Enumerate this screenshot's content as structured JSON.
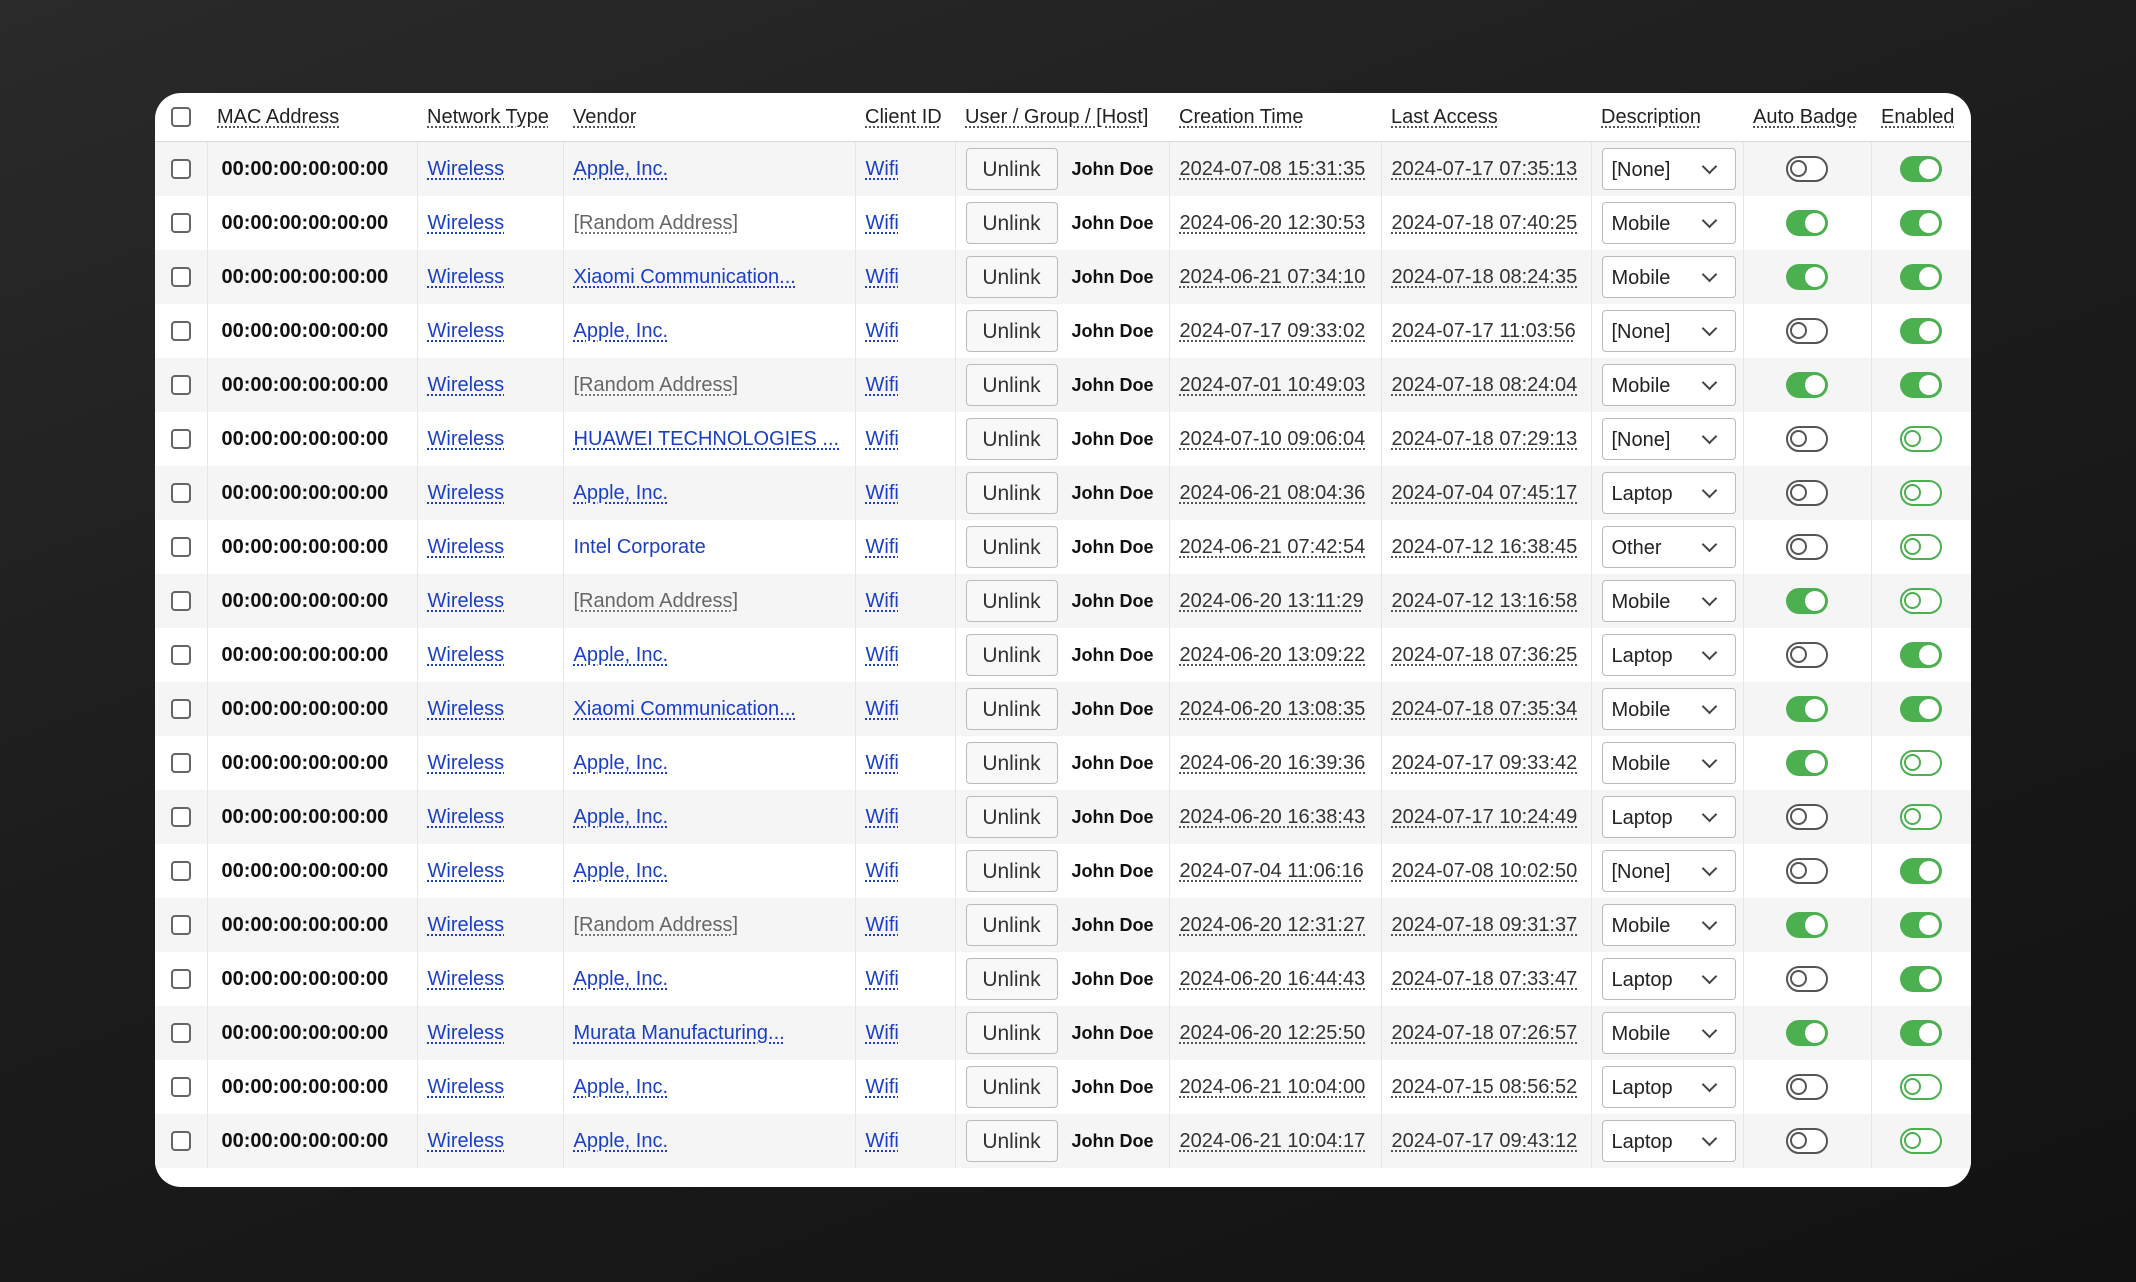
{
  "columns": [
    "MAC Address",
    "Network Type",
    "Vendor",
    "Client ID",
    "User / Group / [Host]",
    "Creation Time",
    "Last Access",
    "Description",
    "Auto Badge",
    "Enabled"
  ],
  "unlink_label": "Unlink",
  "rows": [
    {
      "mac": "00:00:00:00:00:00",
      "network": "Wireless",
      "vendor": "Apple, Inc.",
      "vendor_kind": "link",
      "client": "Wifi",
      "user": "John Doe",
      "created": "2024-07-08 15:31:35",
      "last": "2024-07-17 07:35:13",
      "desc": "[None]",
      "auto_badge": "off",
      "enabled": "on"
    },
    {
      "mac": "00:00:00:00:00:00",
      "network": "Wireless",
      "vendor": "[Random Address]",
      "vendor_kind": "random",
      "client": "Wifi",
      "user": "John Doe",
      "created": "2024-06-20 12:30:53",
      "last": "2024-07-18 07:40:25",
      "desc": "Mobile",
      "auto_badge": "on",
      "enabled": "on"
    },
    {
      "mac": "00:00:00:00:00:00",
      "network": "Wireless",
      "vendor": "Xiaomi Communication...",
      "vendor_kind": "link",
      "client": "Wifi",
      "user": "John Doe",
      "created": "2024-06-21 07:34:10",
      "last": "2024-07-18 08:24:35",
      "desc": "Mobile",
      "auto_badge": "on",
      "enabled": "on"
    },
    {
      "mac": "00:00:00:00:00:00",
      "network": "Wireless",
      "vendor": "Apple, Inc.",
      "vendor_kind": "link",
      "client": "Wifi",
      "user": "John Doe",
      "created": "2024-07-17 09:33:02",
      "last": "2024-07-17 11:03:56",
      "desc": "[None]",
      "auto_badge": "off",
      "enabled": "on"
    },
    {
      "mac": "00:00:00:00:00:00",
      "network": "Wireless",
      "vendor": "[Random Address]",
      "vendor_kind": "random",
      "client": "Wifi",
      "user": "John Doe",
      "created": "2024-07-01 10:49:03",
      "last": "2024-07-18 08:24:04",
      "desc": "Mobile",
      "auto_badge": "on",
      "enabled": "on"
    },
    {
      "mac": "00:00:00:00:00:00",
      "network": "Wireless",
      "vendor": "HUAWEI TECHNOLOGIES ...",
      "vendor_kind": "link",
      "client": "Wifi",
      "user": "John Doe",
      "created": "2024-07-10 09:06:04",
      "last": "2024-07-18 07:29:13",
      "desc": "[None]",
      "auto_badge": "off",
      "enabled": "ghost"
    },
    {
      "mac": "00:00:00:00:00:00",
      "network": "Wireless",
      "vendor": "Apple, Inc.",
      "vendor_kind": "link",
      "client": "Wifi",
      "user": "John Doe",
      "created": "2024-06-21 08:04:36",
      "last": "2024-07-04 07:45:17",
      "desc": "Laptop",
      "auto_badge": "off",
      "enabled": "ghost"
    },
    {
      "mac": "00:00:00:00:00:00",
      "network": "Wireless",
      "vendor": "Intel Corporate",
      "vendor_kind": "plain",
      "client": "Wifi",
      "user": "John Doe",
      "created": "2024-06-21 07:42:54",
      "last": "2024-07-12 16:38:45",
      "desc": "Other",
      "auto_badge": "off",
      "enabled": "ghost"
    },
    {
      "mac": "00:00:00:00:00:00",
      "network": "Wireless",
      "vendor": "[Random Address]",
      "vendor_kind": "random",
      "client": "Wifi",
      "user": "John Doe",
      "created": "2024-06-20 13:11:29",
      "last": "2024-07-12 13:16:58",
      "desc": "Mobile",
      "auto_badge": "on",
      "enabled": "ghost"
    },
    {
      "mac": "00:00:00:00:00:00",
      "network": "Wireless",
      "vendor": "Apple, Inc.",
      "vendor_kind": "link",
      "client": "Wifi",
      "user": "John Doe",
      "created": "2024-06-20 13:09:22",
      "last": "2024-07-18 07:36:25",
      "desc": "Laptop",
      "auto_badge": "off",
      "enabled": "on"
    },
    {
      "mac": "00:00:00:00:00:00",
      "network": "Wireless",
      "vendor": "Xiaomi Communication...",
      "vendor_kind": "link",
      "client": "Wifi",
      "user": "John Doe",
      "created": "2024-06-20 13:08:35",
      "last": "2024-07-18 07:35:34",
      "desc": "Mobile",
      "auto_badge": "on",
      "enabled": "on"
    },
    {
      "mac": "00:00:00:00:00:00",
      "network": "Wireless",
      "vendor": "Apple, Inc.",
      "vendor_kind": "link",
      "client": "Wifi",
      "user": "John Doe",
      "created": "2024-06-20 16:39:36",
      "last": "2024-07-17 09:33:42",
      "desc": "Mobile",
      "auto_badge": "on",
      "enabled": "ghost"
    },
    {
      "mac": "00:00:00:00:00:00",
      "network": "Wireless",
      "vendor": "Apple, Inc.",
      "vendor_kind": "link",
      "client": "Wifi",
      "user": "John Doe",
      "created": "2024-06-20 16:38:43",
      "last": "2024-07-17 10:24:49",
      "desc": "Laptop",
      "auto_badge": "off",
      "enabled": "ghost"
    },
    {
      "mac": "00:00:00:00:00:00",
      "network": "Wireless",
      "vendor": "Apple, Inc.",
      "vendor_kind": "link",
      "client": "Wifi",
      "user": "John Doe",
      "created": "2024-07-04 11:06:16",
      "last": "2024-07-08 10:02:50",
      "desc": "[None]",
      "auto_badge": "off",
      "enabled": "on"
    },
    {
      "mac": "00:00:00:00:00:00",
      "network": "Wireless",
      "vendor": "[Random Address]",
      "vendor_kind": "random",
      "client": "Wifi",
      "user": "John Doe",
      "created": "2024-06-20 12:31:27",
      "last": "2024-07-18 09:31:37",
      "desc": "Mobile",
      "auto_badge": "on",
      "enabled": "on"
    },
    {
      "mac": "00:00:00:00:00:00",
      "network": "Wireless",
      "vendor": "Apple, Inc.",
      "vendor_kind": "link",
      "client": "Wifi",
      "user": "John Doe",
      "created": "2024-06-20 16:44:43",
      "last": "2024-07-18 07:33:47",
      "desc": "Laptop",
      "auto_badge": "off",
      "enabled": "on"
    },
    {
      "mac": "00:00:00:00:00:00",
      "network": "Wireless",
      "vendor": "Murata Manufacturing...",
      "vendor_kind": "link",
      "client": "Wifi",
      "user": "John Doe",
      "created": "2024-06-20 12:25:50",
      "last": "2024-07-18 07:26:57",
      "desc": "Mobile",
      "auto_badge": "on",
      "enabled": "on"
    },
    {
      "mac": "00:00:00:00:00:00",
      "network": "Wireless",
      "vendor": "Apple, Inc.",
      "vendor_kind": "link",
      "client": "Wifi",
      "user": "John Doe",
      "created": "2024-06-21 10:04:00",
      "last": "2024-07-15 08:56:52",
      "desc": "Laptop",
      "auto_badge": "off",
      "enabled": "ghost"
    },
    {
      "mac": "00:00:00:00:00:00",
      "network": "Wireless",
      "vendor": "Apple, Inc.",
      "vendor_kind": "link",
      "client": "Wifi",
      "user": "John Doe",
      "created": "2024-06-21 10:04:17",
      "last": "2024-07-17 09:43:12",
      "desc": "Laptop",
      "auto_badge": "off",
      "enabled": "ghost"
    }
  ]
}
